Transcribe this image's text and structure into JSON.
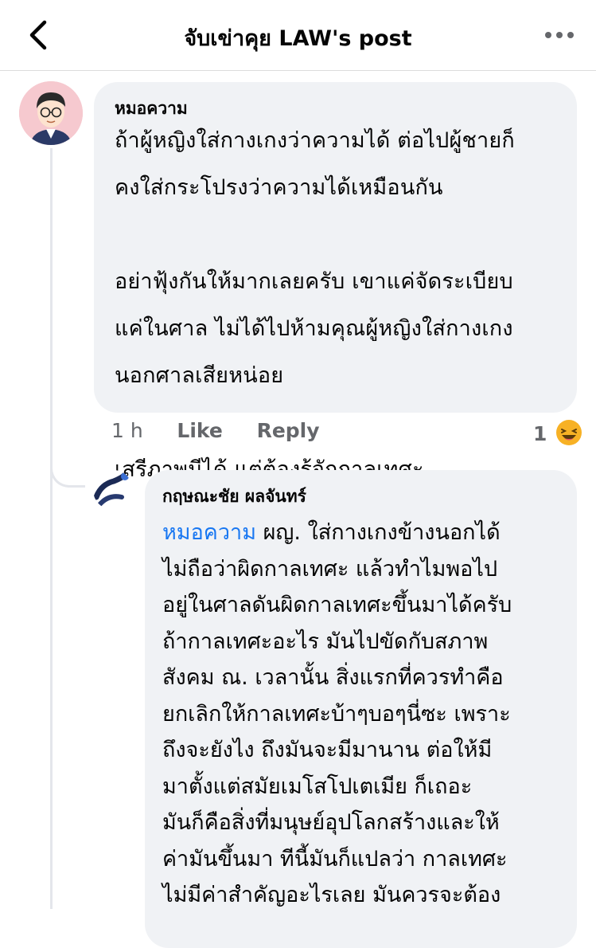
{
  "header": {
    "title": "จับเข่าคุย LAW's post",
    "back_icon": "chevron-left-icon",
    "more_icon": "more-horizontal-icon"
  },
  "comment": {
    "author": "หมอความ",
    "text": "ถ้าผู้หญิงใส่กางเกงว่าความได้ ต่อไปผู้ชายก็\nคงใส่กระโปรงว่าความได้เหมือนกัน\n\nอย่าฟุ้งกันให้มากเลยครับ เขาแค่จัดระเบียบ\nแค่ในศาล ไม่ได้ไปห้ามคุณผู้หญิงใส่กางเกง\nนอกศาลเสียหน่อย\n\nเสรีภาพมีได้ แต่ต้องรู้จักกาลเทศะ",
    "time": "1 h",
    "like_label": "Like",
    "reply_label": "Reply",
    "reaction_count": "1",
    "reaction_icon": "laughing-emoji-icon"
  },
  "reply": {
    "author": "กฤษณะชัย ผลจันทร์",
    "mention": "หมอความ",
    "lines": [
      " ผญ. ใส่กางเกงข้างนอกได้",
      "ไม่ถือว่าผิดกาลเทศะ แล้วทำไมพอไป",
      "อยู่ในศาลดันผิดกาลเทศะขึ้นมาได้ครับ",
      "ถ้ากาลเทศะอะไร มันไปขัดกับสภาพ",
      "สังคม ณ. เวลานั้น สิ่งแรกที่ควรทำคือ",
      "ยกเลิกให้กาลเทศะบ้าๆบอๆนี่ซะ เพราะ",
      "ถึงจะยังไง ถึงมันจะมีมานาน ต่อให้มี",
      "มาตั้งแต่สมัยเมโสโปเตเมีย ก็เถอะ",
      "มันก็คือสิ่งที่มนุษย์อุปโลกสร้างและให้",
      "ค่ามันขึ้นมา ทีนี้มันก็แปลว่า กาลเทศะ",
      "ไม่มีค่าสำคัญอะไรเลย มันควรจะต้อง"
    ]
  }
}
